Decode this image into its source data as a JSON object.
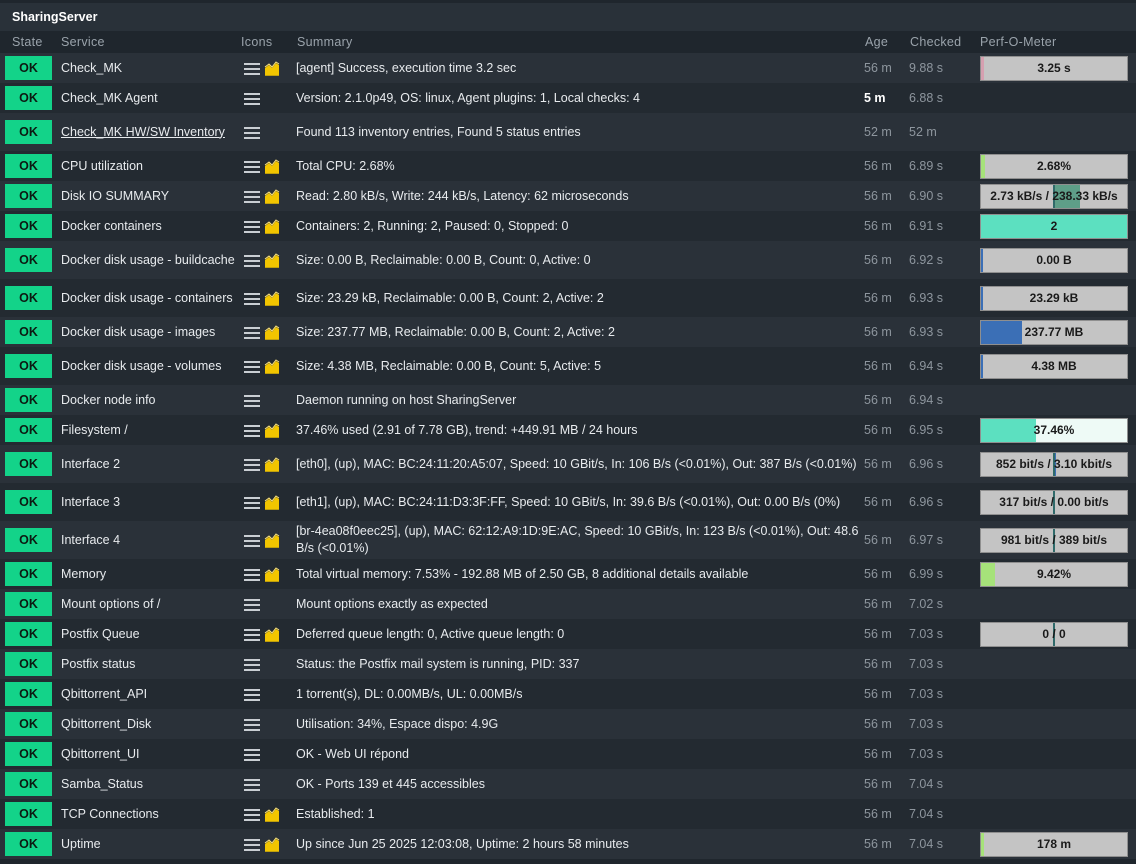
{
  "window": {
    "title": "SharingServer"
  },
  "columns": {
    "state": "State",
    "service": "Service",
    "icons": "Icons",
    "summary": "Summary",
    "age": "Age",
    "checked": "Checked",
    "perf": "Perf-O-Meter"
  },
  "colors": {
    "ok": "#13d389",
    "teal": "#5ce0c0",
    "blue": "#3b6fb6",
    "green": "#a6e27a",
    "gray": "#c4c4c4"
  },
  "rows": [
    {
      "state": "OK",
      "service": "Check_MK",
      "link": false,
      "graph": true,
      "summary": "[agent] Success, execution time 3.2 sec",
      "age": "56 m",
      "checked": "9.88 s",
      "perf": {
        "text": "3.25 s",
        "fill": 0.02,
        "color": "#d6a0b0",
        "mode": "single"
      }
    },
    {
      "state": "OK",
      "service": "Check_MK Agent",
      "link": false,
      "graph": false,
      "summary": "Version: 2.1.0p49, OS: linux, Agent plugins: 1, Local checks: 4",
      "age": "5 m",
      "age_recent": true,
      "checked": "6.88 s",
      "perf": null
    },
    {
      "state": "OK",
      "service": "Check_MK HW/SW Inventory",
      "link": true,
      "graph": false,
      "summary": "Found 113 inventory entries, Found 5 status entries",
      "age": "52 m",
      "checked": "52 m",
      "perf": null
    },
    {
      "state": "OK",
      "service": "CPU utilization",
      "link": false,
      "graph": true,
      "summary": "Total CPU: 2.68%",
      "age": "56 m",
      "checked": "6.89 s",
      "perf": {
        "text": "2.68%",
        "fill": 0.0268,
        "color": "#a6e27a",
        "mode": "single"
      }
    },
    {
      "state": "OK",
      "service": "Disk IO SUMMARY",
      "link": false,
      "graph": true,
      "summary": "Read: 2.80 kB/s, Write: 244 kB/s, Latency: 62 microseconds",
      "age": "56 m",
      "checked": "6.90 s",
      "perf": {
        "text": "2.73 kB/s / 238.33 kB/s",
        "left": 0.84,
        "left_color": "#c4c4c4",
        "right": 0.36,
        "right_color": "#5e9e88",
        "mode": "dual-center"
      }
    },
    {
      "state": "OK",
      "service": "Docker containers",
      "link": false,
      "graph": true,
      "summary": "Containers: 2, Running: 2, Paused: 0, Stopped: 0",
      "age": "56 m",
      "checked": "6.91 s",
      "perf": {
        "text": "2",
        "fill": 1.0,
        "color": "#5ce0c0",
        "mode": "single"
      }
    },
    {
      "state": "OK",
      "service": "Docker disk usage - buildcache",
      "link": false,
      "graph": true,
      "summary": "Size: 0.00 B, Reclaimable: 0.00 B, Count: 0, Active: 0",
      "age": "56 m",
      "checked": "6.92 s",
      "perf": {
        "text": "0.00 B",
        "fill": 0.0,
        "color": "#3b6fb6",
        "mode": "single"
      }
    },
    {
      "state": "OK",
      "service": "Docker disk usage - containers",
      "link": false,
      "graph": true,
      "summary": "Size: 23.29 kB, Reclaimable: 0.00 B, Count: 2, Active: 2",
      "age": "56 m",
      "checked": "6.93 s",
      "perf": {
        "text": "23.29 kB",
        "fill": 0.01,
        "color": "#3b6fb6",
        "mode": "single"
      }
    },
    {
      "state": "OK",
      "service": "Docker disk usage - images",
      "link": false,
      "graph": true,
      "summary": "Size: 237.77 MB, Reclaimable: 0.00 B, Count: 2, Active: 2",
      "age": "56 m",
      "checked": "6.93 s",
      "perf": {
        "text": "237.77 MB",
        "fill": 0.28,
        "color": "#3b6fb6",
        "mode": "single"
      }
    },
    {
      "state": "OK",
      "service": "Docker disk usage - volumes",
      "link": false,
      "graph": true,
      "summary": "Size: 4.38 MB, Reclaimable: 0.00 B, Count: 5, Active: 5",
      "age": "56 m",
      "checked": "6.94 s",
      "perf": {
        "text": "4.38 MB",
        "fill": 0.01,
        "color": "#3b6fb6",
        "mode": "single"
      }
    },
    {
      "state": "OK",
      "service": "Docker node info",
      "link": false,
      "graph": false,
      "summary": "Daemon running on host SharingServer",
      "age": "56 m",
      "checked": "6.94 s",
      "perf": null
    },
    {
      "state": "OK",
      "service": "Filesystem /",
      "link": false,
      "graph": true,
      "summary": "37.46% used (2.91 of 7.78 GB), trend: +449.91 MB / 24 hours",
      "age": "56 m",
      "checked": "6.95 s",
      "perf": {
        "text": "37.46%",
        "fill": 0.3746,
        "color": "#5ce0c0",
        "rest_color": "#eefaf6",
        "mode": "single"
      }
    },
    {
      "state": "OK",
      "service": "Interface 2",
      "link": false,
      "graph": true,
      "summary": "[eth0], (up), MAC: BC:24:11:20:A5:07, Speed: 10 GBit/s, In: 106 B/s (<0.01%), Out: 387 B/s (<0.01%)",
      "age": "56 m",
      "checked": "6.96 s",
      "perf": {
        "text": "852 bit/s / 3.10 kbit/s",
        "left": 0.0,
        "right": 0.01,
        "right_color": "#3b6fb6",
        "mode": "dual-center"
      }
    },
    {
      "state": "OK",
      "service": "Interface 3",
      "link": false,
      "graph": true,
      "summary": "[eth1], (up), MAC: BC:24:11:D3:3F:FF, Speed: 10 GBit/s, In: 39.6 B/s (<0.01%), Out: 0.00 B/s (0%)",
      "age": "56 m",
      "checked": "6.96 s",
      "perf": {
        "text": "317 bit/s / 0.00 bit/s",
        "left": 0.0,
        "right": 0.0,
        "mode": "dual-center"
      }
    },
    {
      "state": "OK",
      "service": "Interface 4",
      "link": false,
      "graph": true,
      "summary": "[br-4ea08f0eec25], (up), MAC: 62:12:A9:1D:9E:AC, Speed: 10 GBit/s, In: 123 B/s (<0.01%), Out: 48.6 B/s (<0.01%)",
      "age": "56 m",
      "checked": "6.97 s",
      "perf": {
        "text": "981 bit/s / 389 bit/s",
        "left": 0.0,
        "right": 0.0,
        "mode": "dual-center"
      }
    },
    {
      "state": "OK",
      "service": "Memory",
      "link": false,
      "graph": true,
      "summary": "Total virtual memory: 7.53% - 192.88 MB of 2.50 GB, 8 additional details available",
      "age": "56 m",
      "checked": "6.99 s",
      "perf": {
        "text": "9.42%",
        "fill": 0.0942,
        "color": "#a6e27a",
        "mode": "single"
      }
    },
    {
      "state": "OK",
      "service": "Mount options of /",
      "link": false,
      "graph": false,
      "summary": "Mount options exactly as expected",
      "age": "56 m",
      "checked": "7.02 s",
      "perf": null
    },
    {
      "state": "OK",
      "service": "Postfix Queue",
      "link": false,
      "graph": true,
      "summary": "Deferred queue length: 0, Active queue length: 0",
      "age": "56 m",
      "checked": "7.03 s",
      "perf": {
        "text": "0 / 0",
        "left": 0.0,
        "right": 0.0,
        "mode": "dual-center"
      }
    },
    {
      "state": "OK",
      "service": "Postfix status",
      "link": false,
      "graph": false,
      "summary": "Status: the Postfix mail system is running, PID: 337",
      "age": "56 m",
      "checked": "7.03 s",
      "perf": null
    },
    {
      "state": "OK",
      "service": "Qbittorrent_API",
      "link": false,
      "graph": false,
      "summary": "1 torrent(s), DL: 0.00MB/s, UL: 0.00MB/s",
      "age": "56 m",
      "checked": "7.03 s",
      "perf": null
    },
    {
      "state": "OK",
      "service": "Qbittorrent_Disk",
      "link": false,
      "graph": false,
      "summary": "Utilisation: 34%, Espace dispo: 4.9G",
      "age": "56 m",
      "checked": "7.03 s",
      "perf": null
    },
    {
      "state": "OK",
      "service": "Qbittorrent_UI",
      "link": false,
      "graph": false,
      "summary": "OK - Web UI répond",
      "age": "56 m",
      "checked": "7.03 s",
      "perf": null
    },
    {
      "state": "OK",
      "service": "Samba_Status",
      "link": false,
      "graph": false,
      "summary": "OK - Ports 139 et 445 accessibles",
      "age": "56 m",
      "checked": "7.04 s",
      "perf": null
    },
    {
      "state": "OK",
      "service": "TCP Connections",
      "link": false,
      "graph": true,
      "summary": "Established: 1",
      "age": "56 m",
      "checked": "7.04 s",
      "perf": null
    },
    {
      "state": "OK",
      "service": "Uptime",
      "link": false,
      "graph": true,
      "summary": "Up since Jun 25 2025 12:03:08, Uptime: 2 hours 58 minutes",
      "age": "56 m",
      "checked": "7.04 s",
      "perf": {
        "text": "178 m",
        "fill": 0.02,
        "color": "#a6e27a",
        "mode": "single"
      }
    }
  ]
}
